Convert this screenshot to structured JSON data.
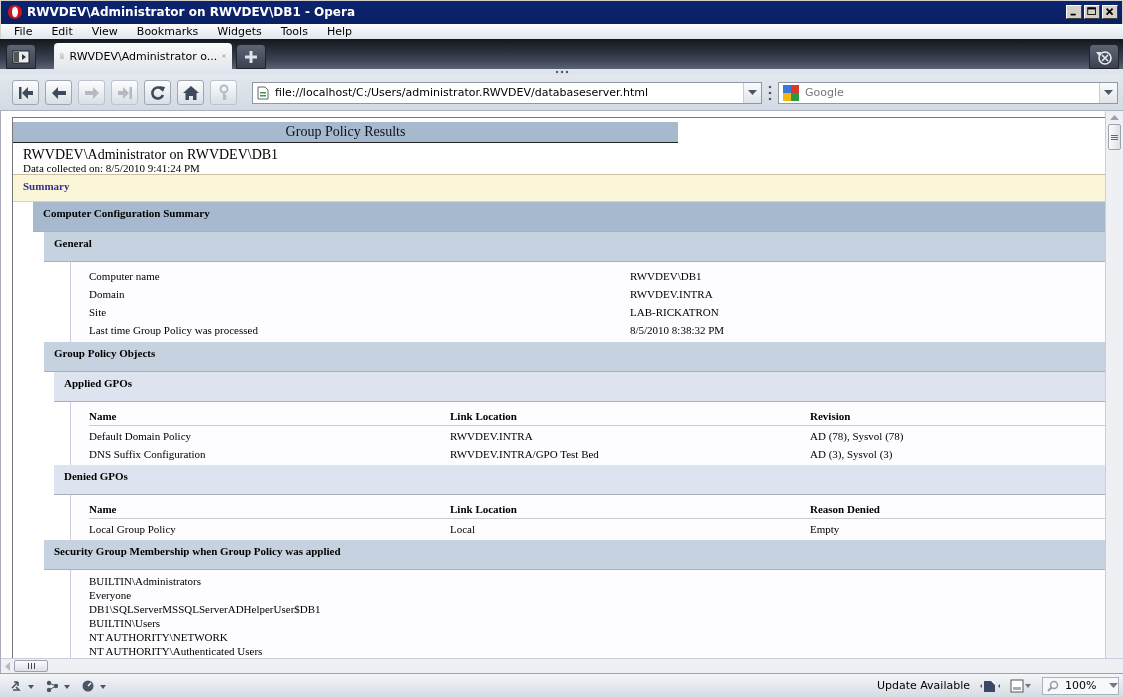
{
  "window": {
    "title": "RWVDEV\\Administrator on RWVDEV\\DB1 - Opera"
  },
  "menu": [
    "File",
    "Edit",
    "View",
    "Bookmarks",
    "Widgets",
    "Tools",
    "Help"
  ],
  "tabs": [
    {
      "label": "RWVDEV\\Administrator o...",
      "selected": true
    }
  ],
  "toolbar": [
    {
      "kind": "rewind",
      "disabled": false
    },
    {
      "kind": "back",
      "disabled": false
    },
    {
      "kind": "forward",
      "disabled": true
    },
    {
      "kind": "fast-forward",
      "disabled": true
    },
    {
      "kind": "reload",
      "disabled": false
    },
    {
      "kind": "home",
      "disabled": false
    },
    {
      "kind": "key",
      "disabled": true
    }
  ],
  "address_bar": {
    "value": "file://localhost/C:/Users/administrator.RWVDEV/databaseserver.html"
  },
  "search": {
    "placeholder": "Google"
  },
  "report": {
    "title": "Group Policy Results",
    "heading": "RWVDEV\\Administrator on RWVDEV\\DB1",
    "collected": "Data collected on: 8/5/2010 9:41:24 PM",
    "summary_link": "Summary",
    "sections": [
      {
        "title": "Computer Configuration Summary",
        "children": [
          {
            "title": "General",
            "details": [
              {
                "label": "Computer name",
                "value": "RWVDEV\\DB1"
              },
              {
                "label": "Domain",
                "value": "RWVDEV.INTRA"
              },
              {
                "label": "Site",
                "value": "LAB-RICKATRON"
              },
              {
                "label": "Last time Group Policy was processed",
                "value": "8/5/2010 8:38:32 PM"
              }
            ]
          },
          {
            "title": "Group Policy Objects",
            "children": [
              {
                "title": "Applied GPOs",
                "table": {
                  "columns": [
                    "Name",
                    "Link Location",
                    "Revision"
                  ],
                  "rows": [
                    [
                      "Default Domain Policy",
                      "RWVDEV.INTRA",
                      "AD (78), Sysvol (78)"
                    ],
                    [
                      "DNS Suffix Configuration",
                      "RWVDEV.INTRA/GPO Test Bed",
                      "AD (3), Sysvol (3)"
                    ]
                  ]
                }
              },
              {
                "title": "Denied GPOs",
                "table": {
                  "columns": [
                    "Name",
                    "Link Location",
                    "Reason Denied"
                  ],
                  "rows": [
                    [
                      "Local Group Policy",
                      "Local",
                      "Empty"
                    ]
                  ]
                }
              }
            ]
          },
          {
            "title": "Security Group Membership when Group Policy was applied",
            "list": [
              "BUILTIN\\Administrators",
              "Everyone",
              "DB1\\SQLServerMSSQLServerADHelperUser$DB1",
              "BUILTIN\\Users",
              "NT AUTHORITY\\NETWORK",
              "NT AUTHORITY\\Authenticated Users"
            ]
          }
        ]
      }
    ]
  },
  "status_bar": {
    "text": "Update Available",
    "zoom": "100%"
  }
}
